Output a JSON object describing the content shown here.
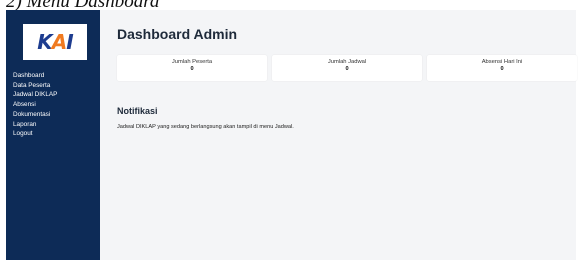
{
  "caption": "2)  Menu Dashboard",
  "sidebar": {
    "logo_text": "KAI",
    "items": [
      {
        "label": "Dashboard"
      },
      {
        "label": "Data Peserta"
      },
      {
        "label": "Jadwal DIKLAP"
      },
      {
        "label": "Absensi"
      },
      {
        "label": "Dokumentasi"
      },
      {
        "label": "Laporan"
      },
      {
        "label": "Logout"
      }
    ]
  },
  "main": {
    "title": "Dashboard Admin",
    "cards": [
      {
        "label": "Jumlah Peserta",
        "value": "0"
      },
      {
        "label": "Jumlah Jadwal",
        "value": "0"
      },
      {
        "label": "Absensi Hari Ini",
        "value": "0"
      }
    ],
    "notification": {
      "title": "Notifikasi",
      "text": "Jadwal DIKLAP yang sedang berlangsung akan tampil di menu Jadwal."
    }
  },
  "colors": {
    "sidebar_bg": "#0d2b57",
    "main_bg": "#f4f5f7",
    "logo_blue": "#1d3c8f",
    "logo_orange": "#f07a20"
  }
}
